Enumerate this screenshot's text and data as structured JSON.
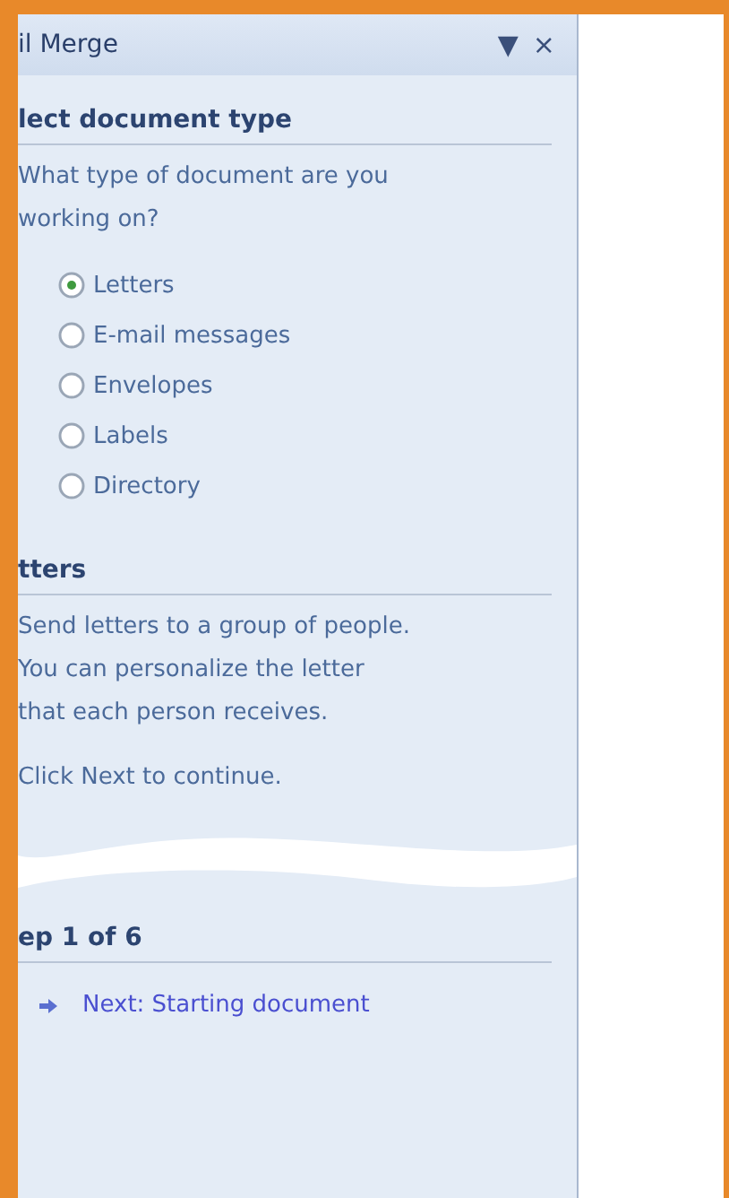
{
  "pane": {
    "title": "il Merge",
    "menu_glyph": "▼",
    "close_glyph": "×"
  },
  "document_type": {
    "heading": "lect document type",
    "question_lines": [
      "What type of document are you",
      "working on?"
    ],
    "options": [
      {
        "label": "Letters",
        "selected": true
      },
      {
        "label": "E-mail messages",
        "selected": false
      },
      {
        "label": "Envelopes",
        "selected": false
      },
      {
        "label": "Labels",
        "selected": false
      },
      {
        "label": "Directory",
        "selected": false
      }
    ]
  },
  "letters": {
    "heading": "tters",
    "description_lines": [
      "Send letters to a group of people.",
      "You can personalize the letter",
      "that each person receives."
    ],
    "hint": "Click Next to continue."
  },
  "step": {
    "heading": "ep 1 of 6",
    "next_link": "Next: Starting document"
  }
}
